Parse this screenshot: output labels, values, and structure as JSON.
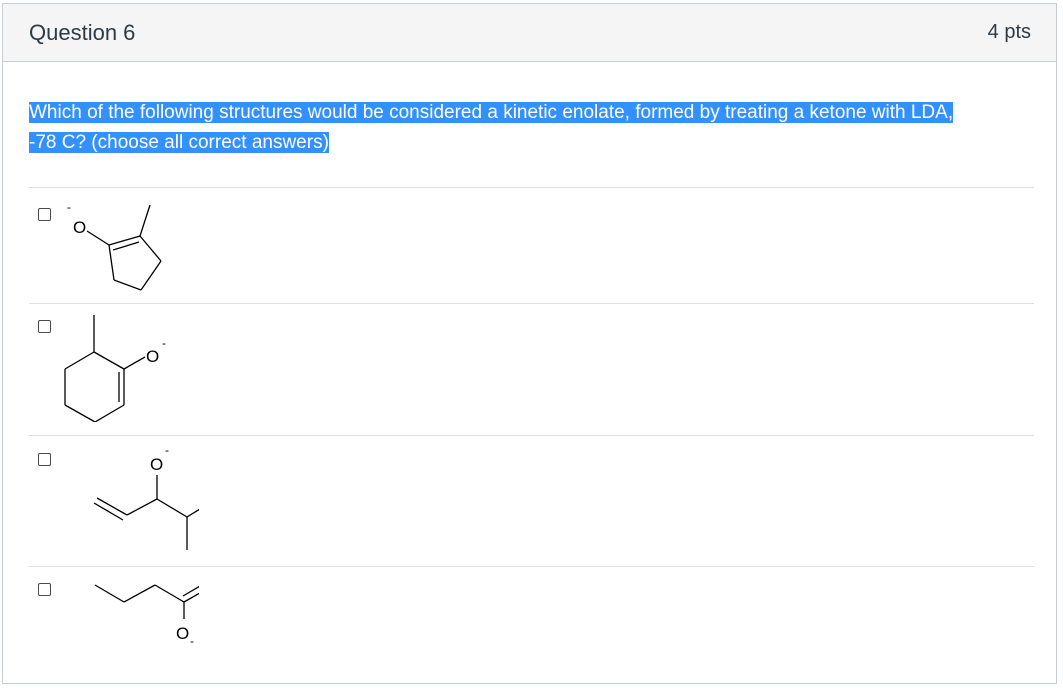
{
  "question": {
    "title": "Question 6",
    "points": "4 pts",
    "text_line1": "Which of the following structures would be considered a kinetic enolate, formed by treating a ketone with LDA,",
    "text_line2": "-78 C? (choose all correct answers)"
  },
  "answers": [
    {
      "structure_labels": {
        "oxygen": "O",
        "charge": "-"
      },
      "checked": false
    },
    {
      "structure_labels": {
        "oxygen": "O",
        "charge": "-"
      },
      "checked": false
    },
    {
      "structure_labels": {
        "oxygen": "O",
        "charge": "-"
      },
      "checked": false
    },
    {
      "structure_labels": {
        "oxygen": "O",
        "charge": "-"
      },
      "checked": false
    }
  ],
  "colors": {
    "highlight": "#3390ff",
    "header_bg": "#f5f5f5",
    "border": "#c7cdd1",
    "text": "#2d3b45"
  }
}
